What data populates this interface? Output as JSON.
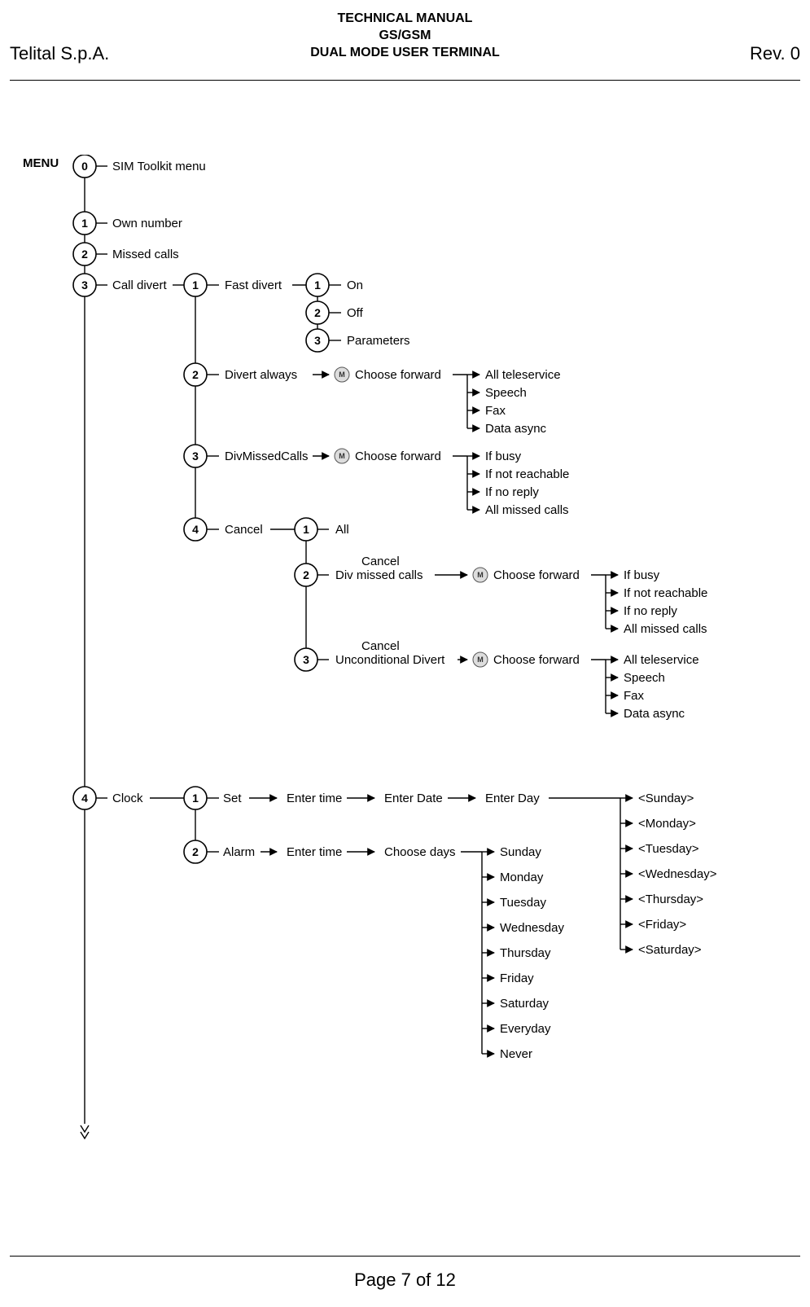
{
  "header": {
    "company": "Telital S.p.A.",
    "title_l1": "TECHNICAL MANUAL",
    "title_l2": "GS/GSM",
    "title_l3": "DUAL MODE USER TERMINAL",
    "revision": "Rev. 0"
  },
  "footer": {
    "page": "Page 7 of 12"
  },
  "menu_label": "MENU",
  "tree": {
    "n0": {
      "num": "0",
      "label": "SIM Toolkit menu"
    },
    "n1": {
      "num": "1",
      "label": "Own number"
    },
    "n2": {
      "num": "2",
      "label": "Missed calls"
    },
    "n3": {
      "num": "3",
      "label": "Call divert"
    },
    "n4": {
      "num": "4",
      "label": "Clock"
    },
    "n3_1": {
      "num": "1",
      "label": "Fast divert"
    },
    "n3_1_1": {
      "num": "1",
      "label": "On"
    },
    "n3_1_2": {
      "num": "2",
      "label": "Off"
    },
    "n3_1_3": {
      "num": "3",
      "label": "Parameters"
    },
    "n3_2": {
      "num": "2",
      "label": "Divert always",
      "action": "Choose forward",
      "opts": [
        "All teleservice",
        "Speech",
        "Fax",
        "Data async"
      ]
    },
    "n3_3": {
      "num": "3",
      "label": "DivMissedCalls",
      "action": "Choose forward",
      "opts": [
        "If busy",
        "If not reachable",
        "If no reply",
        "All missed calls"
      ]
    },
    "n3_4": {
      "num": "4",
      "label": "Cancel"
    },
    "n3_4_1": {
      "num": "1",
      "label": "All"
    },
    "n3_4_2": {
      "num": "2",
      "l1": "Cancel",
      "l2": "Div missed calls",
      "action": "Choose forward",
      "opts": [
        "If busy",
        "If not reachable",
        "If no reply",
        "All missed calls"
      ]
    },
    "n3_4_3": {
      "num": "3",
      "l1": "Cancel",
      "l2": "Unconditional Divert",
      "action": "Choose forward",
      "opts": [
        "All teleservice",
        "Speech",
        "Fax",
        "Data async"
      ]
    },
    "n4_1": {
      "num": "1",
      "label": "Set",
      "steps": [
        "Enter time",
        "Enter Date",
        "Enter Day"
      ],
      "opts": [
        "<Sunday>",
        "<Monday>",
        "<Tuesday>",
        "<Wednesday>",
        "<Thursday>",
        "<Friday>",
        "<Saturday>"
      ]
    },
    "n4_2": {
      "num": "2",
      "label": "Alarm",
      "steps": [
        "Enter time",
        "Choose days"
      ],
      "opts": [
        "Sunday",
        "Monday",
        "Tuesday",
        "Wednesday",
        "Thursday",
        "Friday",
        "Saturday",
        "Everyday",
        "Never"
      ]
    }
  }
}
